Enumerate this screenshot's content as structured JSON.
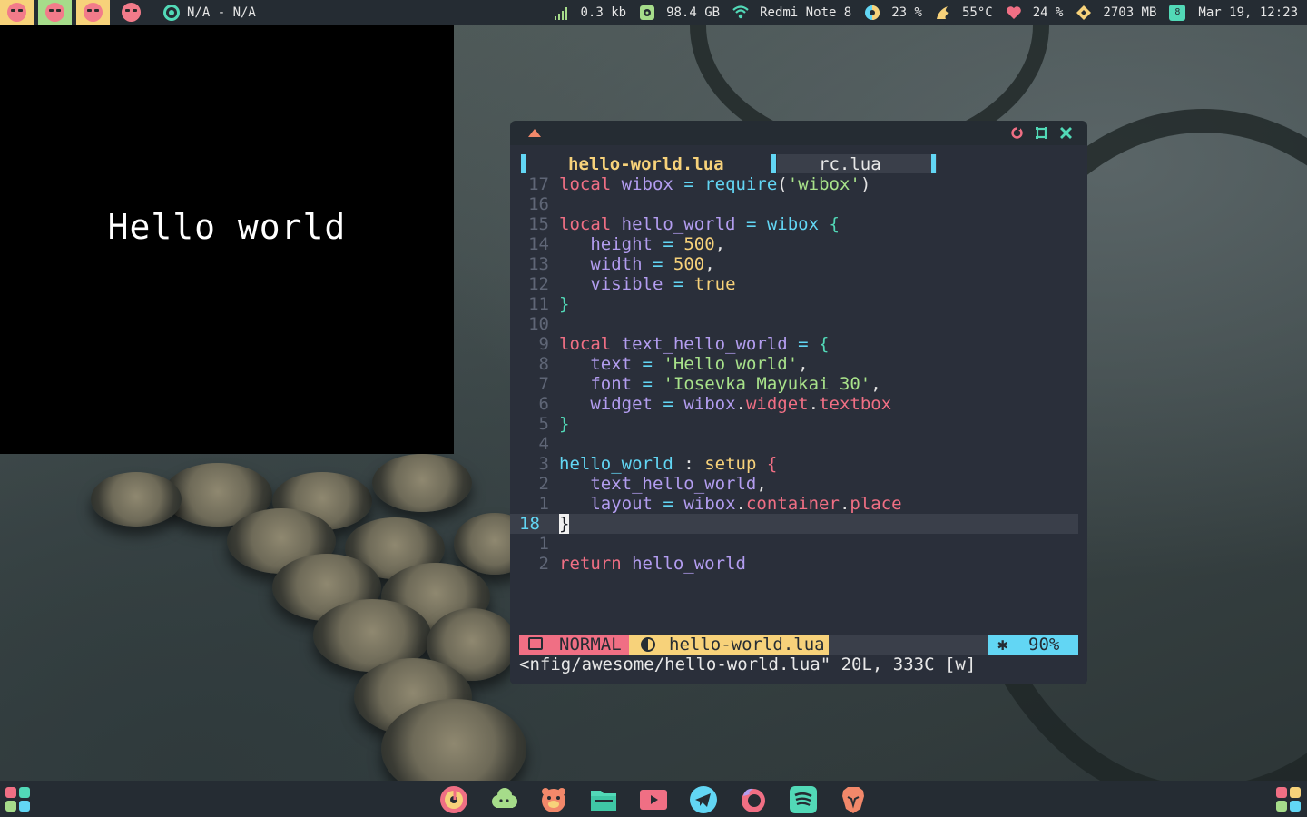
{
  "colors": {
    "bar_bg": "#252c33",
    "editor_bg": "#2a2f3a",
    "accent_cyan": "#62d6f4",
    "accent_yellow": "#f7d27a",
    "accent_pink": "#f06f84",
    "accent_teal": "#52d9b7",
    "accent_green": "#a6dc8a"
  },
  "topbar": {
    "tags": [
      "tag-1",
      "tag-2",
      "tag-3",
      "tag-4"
    ],
    "music_text": "N/A - N/A",
    "network": "0.3 kb",
    "disk": "98.4 GB",
    "wifi": "Redmi Note 8",
    "volume": "23 %",
    "temp": "55°C",
    "battery": "24 %",
    "memory": "2703 MB",
    "clock": "Mar 19, 12:23",
    "clock_badge": "8"
  },
  "hello_window": {
    "text": "Hello world"
  },
  "editor": {
    "tabs": [
      {
        "label": "hello-world.lua",
        "active": true
      },
      {
        "label": "rc.lua",
        "active": false
      }
    ],
    "lines": [
      {
        "ln": "17",
        "code": "local wibox = require('wibox')"
      },
      {
        "ln": "16",
        "code": ""
      },
      {
        "ln": "15",
        "code": "local hello_world = wibox {"
      },
      {
        "ln": "14",
        "code": "   height = 500,"
      },
      {
        "ln": "13",
        "code": "   width = 500,"
      },
      {
        "ln": "12",
        "code": "   visible = true"
      },
      {
        "ln": "11",
        "code": "}"
      },
      {
        "ln": "10",
        "code": ""
      },
      {
        "ln": "9",
        "code": "local text_hello_world = {"
      },
      {
        "ln": "8",
        "code": "   text = 'Hello world',"
      },
      {
        "ln": "7",
        "code": "   font = 'Iosevka Mayukai 30',"
      },
      {
        "ln": "6",
        "code": "   widget = wibox.widget.textbox"
      },
      {
        "ln": "5",
        "code": "}"
      },
      {
        "ln": "4",
        "code": ""
      },
      {
        "ln": "3",
        "code": "hello_world : setup {"
      },
      {
        "ln": "2",
        "code": "   text_hello_world,"
      },
      {
        "ln": "1",
        "code": "   layout = wibox.container.place"
      },
      {
        "ln": "18",
        "code": "}",
        "current": true
      },
      {
        "ln": "1",
        "code": ""
      },
      {
        "ln": "2",
        "code": "return hello_world"
      }
    ],
    "status": {
      "mode": "NORMAL",
      "file": "hello-world.lua",
      "percent": "90%"
    },
    "cmdline": "<nfig/awesome/hello-world.lua\" 20L, 333C [w]",
    "controls": [
      "refresh-icon",
      "maximize-icon",
      "close-icon"
    ]
  },
  "dock": {
    "apps": [
      "music-player-icon",
      "cloud-icon",
      "pig-face-icon",
      "file-manager-icon",
      "video-player-icon",
      "telegram-icon",
      "firefox-icon",
      "spotify-icon",
      "brave-browser-icon"
    ]
  }
}
